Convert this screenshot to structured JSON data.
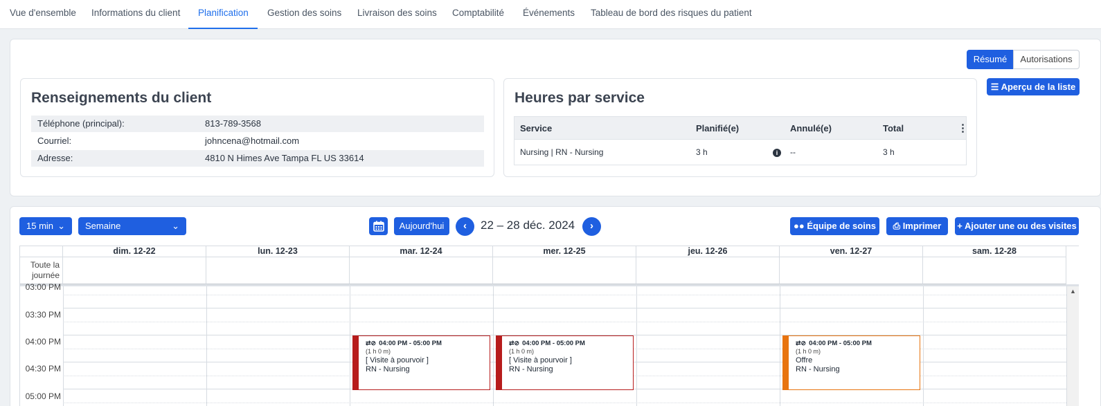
{
  "tabs": [
    "Vue d'ensemble",
    "Informations du client",
    "Planification",
    "Gestion des soins",
    "Livraison des soins",
    "Comptabilité",
    "Événements",
    "Tableau de bord des risques du patient"
  ],
  "active_tab": "Planification",
  "view_toggle": {
    "summary": "Résumé",
    "authorizations": "Autorisations",
    "selected": "Résumé"
  },
  "list_preview_button": "Aperçu de la liste",
  "client_info": {
    "title": "Renseignements du client",
    "rows": [
      {
        "label": "Téléphone (principal):",
        "value": "813-789-3568"
      },
      {
        "label": "Courriel:",
        "value": "johncena@hotmail.com"
      },
      {
        "label": "Adresse:",
        "value": "4810 N Himes Ave Tampa FL US 33614"
      }
    ]
  },
  "hours_by_service": {
    "title": "Heures par service",
    "columns": [
      "Service",
      "Planifié(e)",
      "Annulé(e)",
      "Total"
    ],
    "rows": [
      {
        "service": "Nursing | RN - Nursing",
        "planned": "3 h",
        "cancelled": "--",
        "total": "3 h"
      }
    ]
  },
  "calendar": {
    "interval_select": "15 min",
    "view_select": "Semaine",
    "today_button": "Aujourd'hui",
    "range_label": "22 – 28 déc. 2024",
    "care_team_button": "Équipe de soins",
    "print_button": "Imprimer",
    "add_visits_button": "Ajouter une ou des visites",
    "all_day_label": "Toute la journée",
    "days": [
      "dim. 12-22",
      "lun. 12-23",
      "mar. 12-24",
      "mer. 12-25",
      "jeu. 12-26",
      "ven. 12-27",
      "sam. 12-28"
    ],
    "time_slots": [
      "03:00 PM",
      "03:30 PM",
      "04:00 PM",
      "04:30 PM",
      "05:00 PM"
    ],
    "events": [
      {
        "day": "mar. 12-24",
        "time": "04:00 PM - 05:00 PM",
        "duration": "(1 h 0 m)",
        "status": "[ Visite à pourvoir ]",
        "service": "RN - Nursing",
        "color": "#b71c1c"
      },
      {
        "day": "mer. 12-25",
        "time": "04:00 PM - 05:00 PM",
        "duration": "(1 h 0 m)",
        "status": "[ Visite à pourvoir ]",
        "service": "RN - Nursing",
        "color": "#b71c1c"
      },
      {
        "day": "ven. 12-27",
        "time": "04:00 PM - 05:00 PM",
        "duration": "(1 h 0 m)",
        "status": "Offre",
        "service": "RN - Nursing",
        "color": "#e8740f"
      }
    ]
  },
  "colors": {
    "primary": "#1f5fe0",
    "unfilled_visit": "#b71c1c",
    "offer_visit": "#e8740f"
  }
}
